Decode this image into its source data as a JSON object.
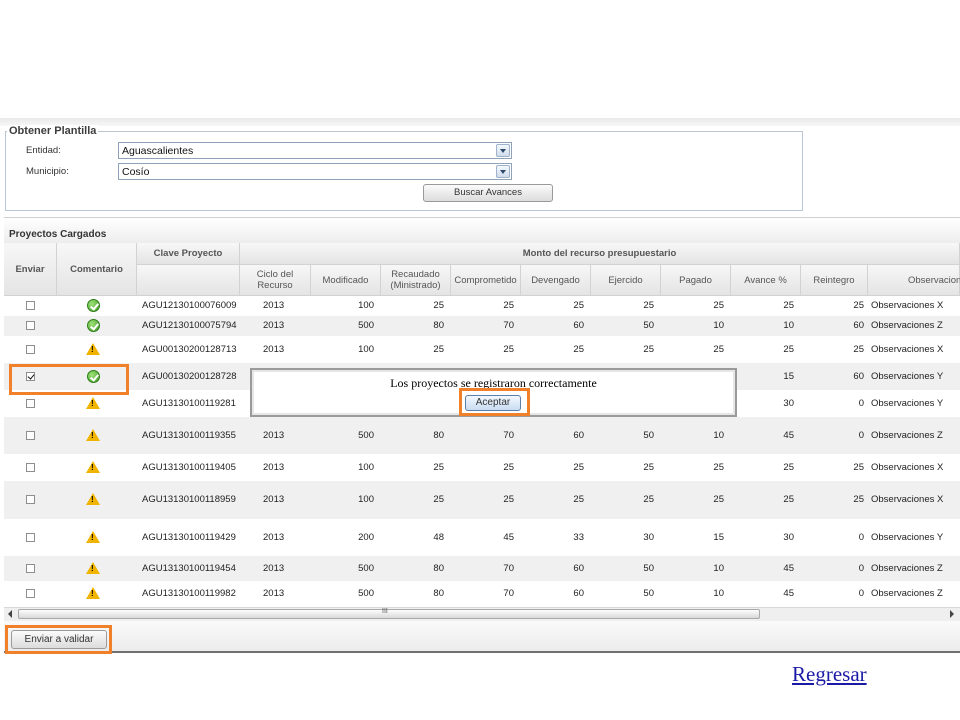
{
  "obtener_plantilla": {
    "legend": "Obtener Plantilla",
    "entidad_label": "Entidad:",
    "entidad_value": "Aguascalientes",
    "municipio_label": "Municipio:",
    "municipio_value": "Cosío",
    "buscar_button": "Buscar Avances"
  },
  "proyectos": {
    "title": "Proyectos Cargados",
    "headers": {
      "enviar": "Enviar",
      "comentario": "Comentario",
      "clave": "Clave Proyecto",
      "monto_group": "Monto del recurso presupuestario",
      "ciclo": "Ciclo del Recurso",
      "modificado": "Modificado",
      "recaudado": "Recaudado (Ministrado)",
      "comprometido": "Comprometido",
      "devengado": "Devengado",
      "ejercido": "Ejercido",
      "pagado": "Pagado",
      "avance": "Avance %",
      "reintegro": "Reintegro",
      "observaciones": "Observacion"
    },
    "rows": [
      {
        "checked": false,
        "status": "ok",
        "clave": "AGU12130100076009",
        "ciclo": "2013",
        "modificado": "100",
        "recaudado": "25",
        "comprometido": "25",
        "devengado": "25",
        "ejercido": "25",
        "pagado": "25",
        "avance": "25",
        "reintegro": "25",
        "obs": "Observaciones X"
      },
      {
        "checked": false,
        "status": "ok",
        "clave": "AGU12130100075794",
        "ciclo": "2013",
        "modificado": "500",
        "recaudado": "80",
        "comprometido": "70",
        "devengado": "60",
        "ejercido": "50",
        "pagado": "10",
        "avance": "10",
        "reintegro": "60",
        "obs": "Observaciones Z"
      },
      {
        "checked": false,
        "status": "warn",
        "clave": "AGU00130200128713",
        "ciclo": "2013",
        "modificado": "100",
        "recaudado": "25",
        "comprometido": "25",
        "devengado": "25",
        "ejercido": "25",
        "pagado": "25",
        "avance": "25",
        "reintegro": "25",
        "obs": "Observaciones X"
      },
      {
        "checked": true,
        "status": "ok",
        "clave": "AGU00130200128728",
        "ciclo": "",
        "modificado": "",
        "recaudado": "",
        "comprometido": "",
        "devengado": "",
        "ejercido": "",
        "pagado": "",
        "avance": "15",
        "reintegro": "60",
        "obs": "Observaciones Y"
      },
      {
        "checked": false,
        "status": "warn",
        "clave": "AGU13130100119281",
        "ciclo": "",
        "modificado": "",
        "recaudado": "",
        "comprometido": "",
        "devengado": "",
        "ejercido": "",
        "pagado": "",
        "avance": "30",
        "reintegro": "0",
        "obs": "Observaciones Y"
      },
      {
        "checked": false,
        "status": "warn",
        "clave": "AGU13130100119355",
        "ciclo": "2013",
        "modificado": "500",
        "recaudado": "80",
        "comprometido": "70",
        "devengado": "60",
        "ejercido": "50",
        "pagado": "10",
        "avance": "45",
        "reintegro": "0",
        "obs": "Observaciones Z"
      },
      {
        "checked": false,
        "status": "warn",
        "clave": "AGU13130100119405",
        "ciclo": "2013",
        "modificado": "100",
        "recaudado": "25",
        "comprometido": "25",
        "devengado": "25",
        "ejercido": "25",
        "pagado": "25",
        "avance": "25",
        "reintegro": "25",
        "obs": "Observaciones X"
      },
      {
        "checked": false,
        "status": "warn",
        "clave": "AGU13130100118959",
        "ciclo": "2013",
        "modificado": "100",
        "recaudado": "25",
        "comprometido": "25",
        "devengado": "25",
        "ejercido": "25",
        "pagado": "25",
        "avance": "25",
        "reintegro": "25",
        "obs": "Observaciones X"
      },
      {
        "checked": false,
        "status": "warn",
        "clave": "AGU13130100119429",
        "ciclo": "2013",
        "modificado": "200",
        "recaudado": "48",
        "comprometido": "45",
        "devengado": "33",
        "ejercido": "30",
        "pagado": "15",
        "avance": "30",
        "reintegro": "0",
        "obs": "Observaciones Y"
      },
      {
        "checked": false,
        "status": "warn",
        "clave": "AGU13130100119454",
        "ciclo": "2013",
        "modificado": "500",
        "recaudado": "80",
        "comprometido": "70",
        "devengado": "60",
        "ejercido": "50",
        "pagado": "10",
        "avance": "45",
        "reintegro": "0",
        "obs": "Observaciones Z"
      },
      {
        "checked": false,
        "status": "warn",
        "clave": "AGU13130100119982",
        "ciclo": "2013",
        "modificado": "500",
        "recaudado": "80",
        "comprometido": "70",
        "devengado": "60",
        "ejercido": "50",
        "pagado": "10",
        "avance": "45",
        "reintegro": "0",
        "obs": "Observaciones Z"
      }
    ]
  },
  "dialog": {
    "message": "Los proyectos se registraron correctamente",
    "ok_button": "Aceptar"
  },
  "scrollbar_grip": "III",
  "footer": {
    "send_button": "Enviar a validar"
  },
  "back_link": "Regresar",
  "colors": {
    "highlight": "#f0802a",
    "ok": "#3c9a22",
    "warning": "#f0b400",
    "link": "#1a1aa6"
  }
}
